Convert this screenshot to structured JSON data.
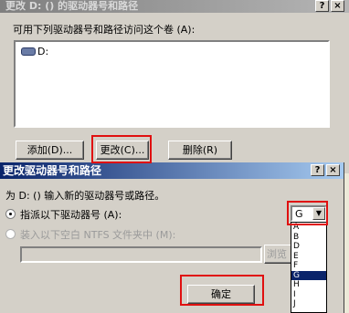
{
  "back_dialog": {
    "title": "更改 D: () 的驱动器号和路径",
    "description": "可用下列驱动器号和路径访问这个卷 (A):",
    "volumes": [
      "D:"
    ],
    "buttons": {
      "add": "添加(D)...",
      "change": "更改(C)...",
      "delete": "删除(R)"
    }
  },
  "front_dialog": {
    "title": "更改驱动器号和路径",
    "help_button": "?",
    "close_button": "×",
    "prompt": "为 D: () 输入新的驱动器号或路径。",
    "assign_option": "指派以下驱动器号 (A):",
    "mount_option": "装入以下空白 NTFS 文件夹中 (M):",
    "browse_button": "浏览",
    "ok_button": "确定"
  },
  "drive_letter": {
    "selected": "G",
    "options": [
      "A",
      "B",
      "D",
      "E",
      "F",
      "G",
      "H",
      "I",
      "J"
    ]
  },
  "back_title_buttons": {
    "help": "?",
    "close": "×"
  }
}
